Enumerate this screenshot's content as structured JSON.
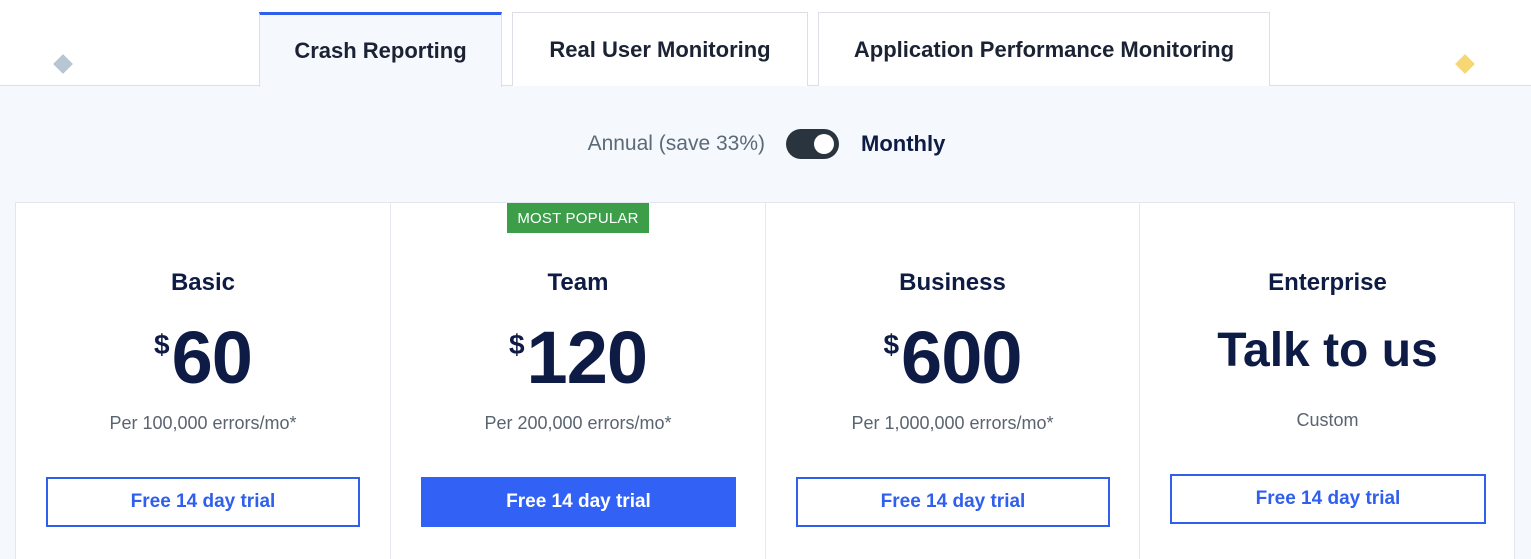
{
  "tabs": [
    {
      "label": "Crash Reporting",
      "active": true
    },
    {
      "label": "Real User Monitoring",
      "active": false
    },
    {
      "label": "Application Performance Monitoring",
      "active": false
    }
  ],
  "billing": {
    "annual_label": "Annual (save 33%)",
    "monthly_label": "Monthly",
    "selected": "Monthly"
  },
  "plans": [
    {
      "name": "Basic",
      "currency": "$",
      "price": "60",
      "description": "Per 100,000 errors/mo*",
      "cta": "Free 14 day trial"
    },
    {
      "name": "Team",
      "badge": "MOST POPULAR",
      "currency": "$",
      "price": "120",
      "description": "Per 200,000 errors/mo*",
      "cta": "Free 14 day trial"
    },
    {
      "name": "Business",
      "currency": "$",
      "price": "600",
      "description": "Per 1,000,000 errors/mo*",
      "cta": "Free 14 day trial"
    },
    {
      "name": "Enterprise",
      "price_text": "Talk to us",
      "description": "Custom",
      "cta": "Free 14 day trial"
    }
  ],
  "colors": {
    "accent": "#2f5fec",
    "badge": "#3d9e4a",
    "heading": "#0d1b45",
    "diamond_left": "#b8c5d3",
    "diamond_right": "#f7d774"
  }
}
